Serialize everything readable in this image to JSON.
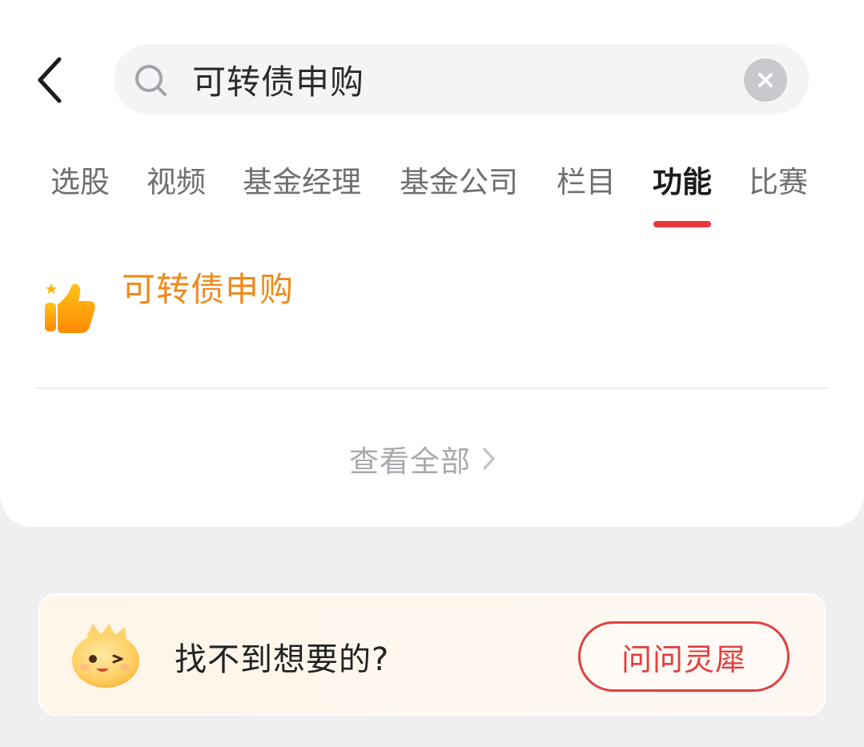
{
  "search": {
    "query": "可转债申购"
  },
  "tabs": [
    {
      "label": "选股"
    },
    {
      "label": "视频"
    },
    {
      "label": "基金经理"
    },
    {
      "label": "基金公司"
    },
    {
      "label": "栏目"
    },
    {
      "label": "功能",
      "active": true
    },
    {
      "label": "比赛"
    }
  ],
  "results": [
    {
      "title": "可转债申购",
      "icon": "thumbs-up-icon"
    }
  ],
  "view_all": {
    "label": "查看全部"
  },
  "banner": {
    "text": "找不到想要的?",
    "button_label": "问问灵犀"
  },
  "colors": {
    "accent_red": "#e8373d",
    "result_orange": "#f08a1c",
    "background": "#efeff1"
  }
}
